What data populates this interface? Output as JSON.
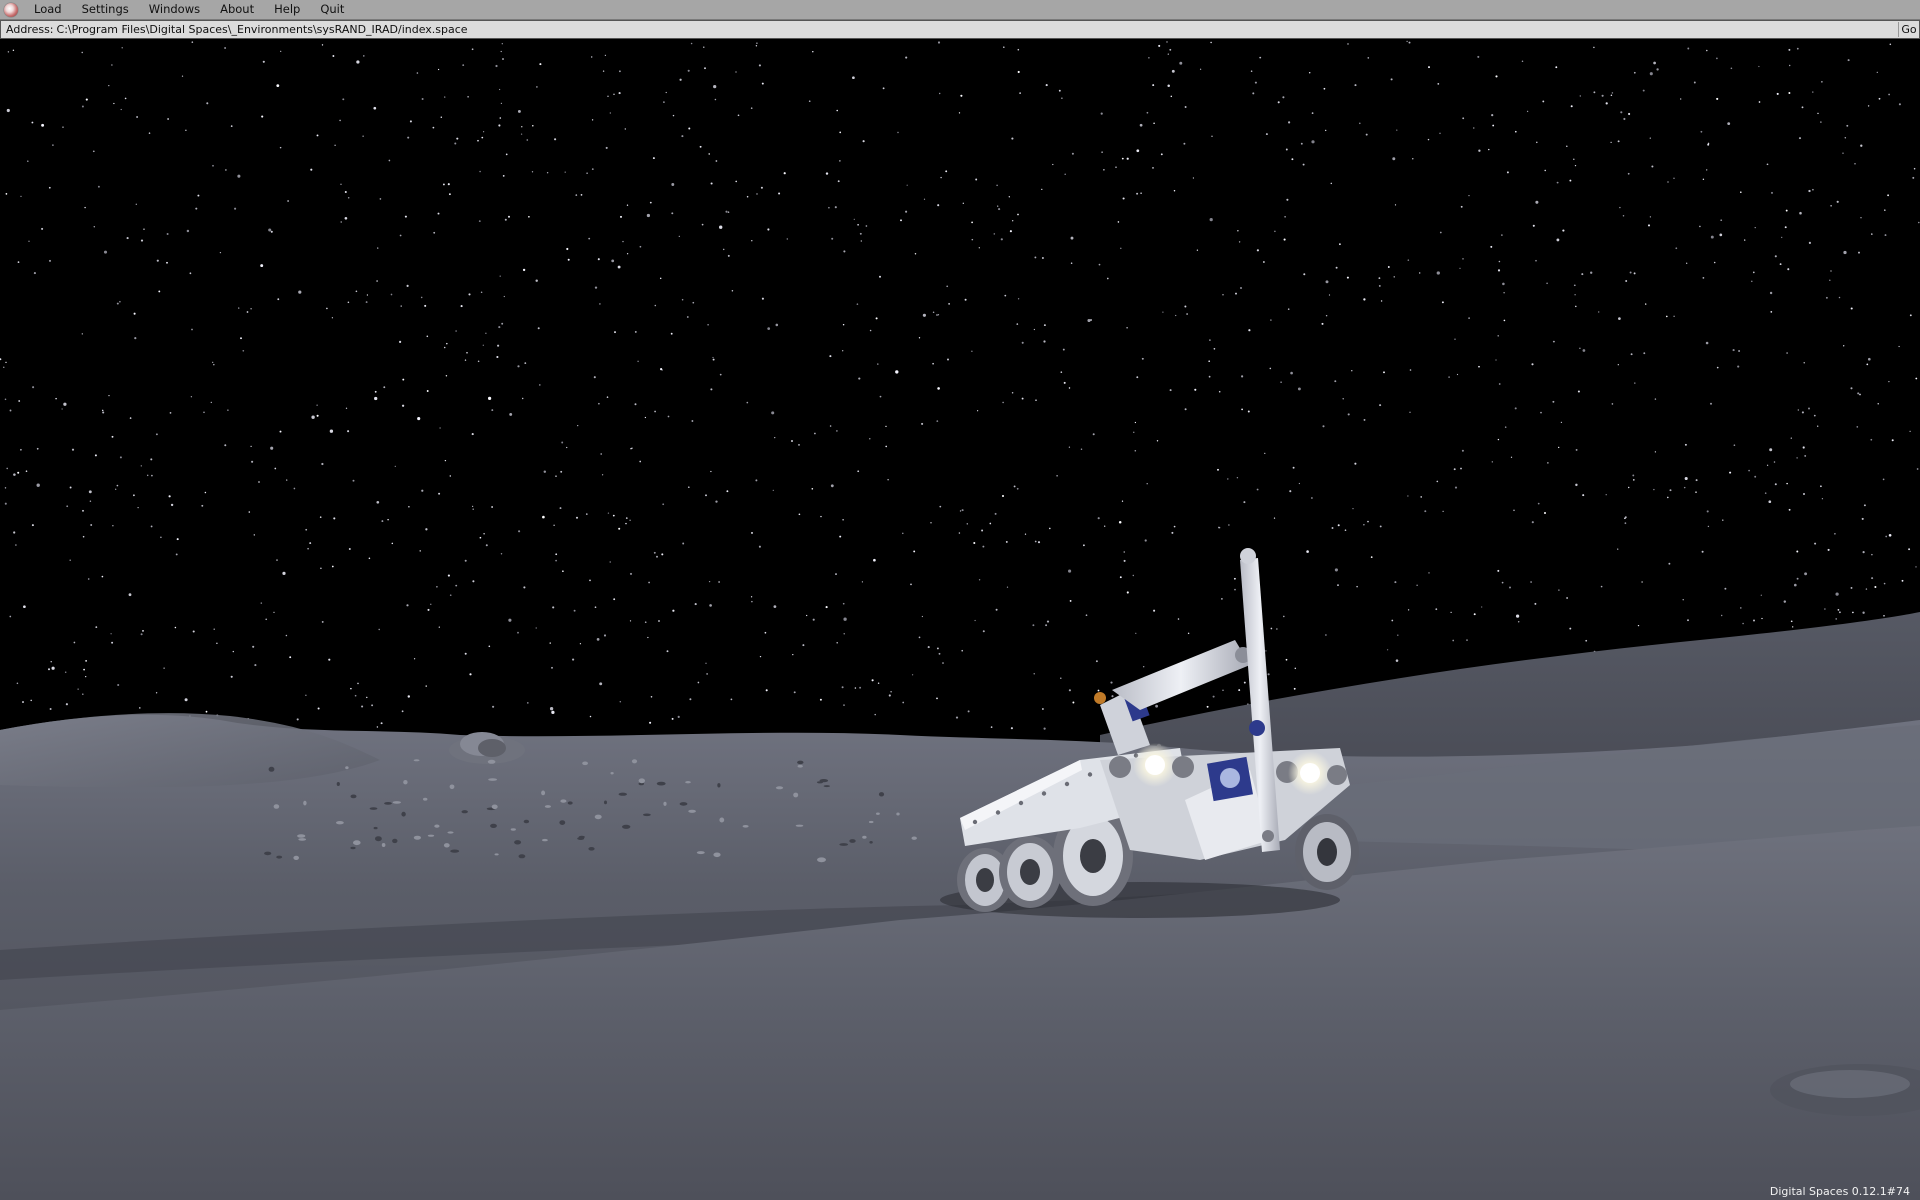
{
  "menu": {
    "items": [
      {
        "id": "load",
        "label": "Load"
      },
      {
        "id": "settings",
        "label": "Settings"
      },
      {
        "id": "windows",
        "label": "Windows"
      },
      {
        "id": "about",
        "label": "About"
      },
      {
        "id": "help",
        "label": "Help"
      },
      {
        "id": "quit",
        "label": "Quit"
      }
    ]
  },
  "address": {
    "label": "Address:",
    "value": "C:\\Program Files\\Digital Spaces\\_Environments\\sysRAND_IRAD/index.space",
    "go_label": "Go"
  },
  "status": {
    "version": "Digital Spaces 0.12.1#74"
  },
  "colors": {
    "sky": "#000000",
    "terrain_light": "#8b8d96",
    "terrain_dark": "#3d3f48",
    "menubar": "#a6a6a6",
    "addressbar": "#dcdcdc",
    "rover_body": "#d9dce4",
    "rover_emblem": "#2d3a8c"
  },
  "icons": {
    "app_logo": "app-logo-icon"
  }
}
